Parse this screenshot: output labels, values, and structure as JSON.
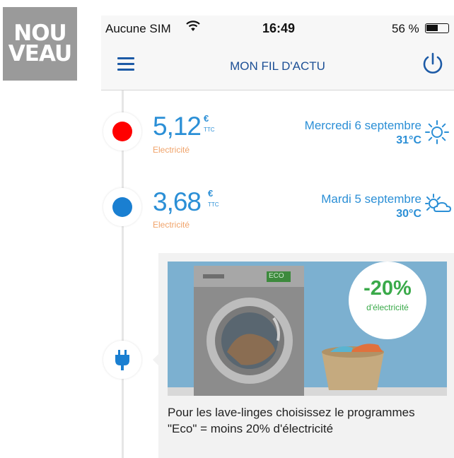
{
  "badge": {
    "line1": "NOU",
    "line2": "VEAU"
  },
  "statusbar": {
    "carrier": "Aucune SIM",
    "time": "16:49",
    "battery_label": "56 %",
    "battery_level": 0.56,
    "wifi_icon": "wifi-icon"
  },
  "navbar": {
    "title": "MON FIL D'ACTU",
    "menu_icon": "menu-icon",
    "power_icon": "power-icon"
  },
  "feed": [
    {
      "dot_color": "#ff0000",
      "price": "5,12",
      "currency": "€",
      "tax": "TTC",
      "energy": "Electricité",
      "date": "Mercredi 6 septembre",
      "temperature": "31°C",
      "weather_icon": "sun-icon"
    },
    {
      "dot_color": "#1a7fd1",
      "price": "3,68",
      "currency": "€",
      "tax": "TTC",
      "energy": "Electricité",
      "date": "Mardi 5 septembre",
      "temperature": "30°C",
      "weather_icon": "sun-cloud-icon"
    }
  ],
  "tip": {
    "icon": "plug-icon",
    "machine_label": "ECO",
    "promo_percent": "-20%",
    "promo_label": "d'électricité",
    "text": "Pour les lave-linges choisissez le programmes \"Eco\" = moins 20% d'électricité"
  },
  "colors": {
    "accent": "#2b8fd6",
    "nav": "#1c4f95",
    "energy": "#f0a36a",
    "promo": "#3aaa4a"
  }
}
